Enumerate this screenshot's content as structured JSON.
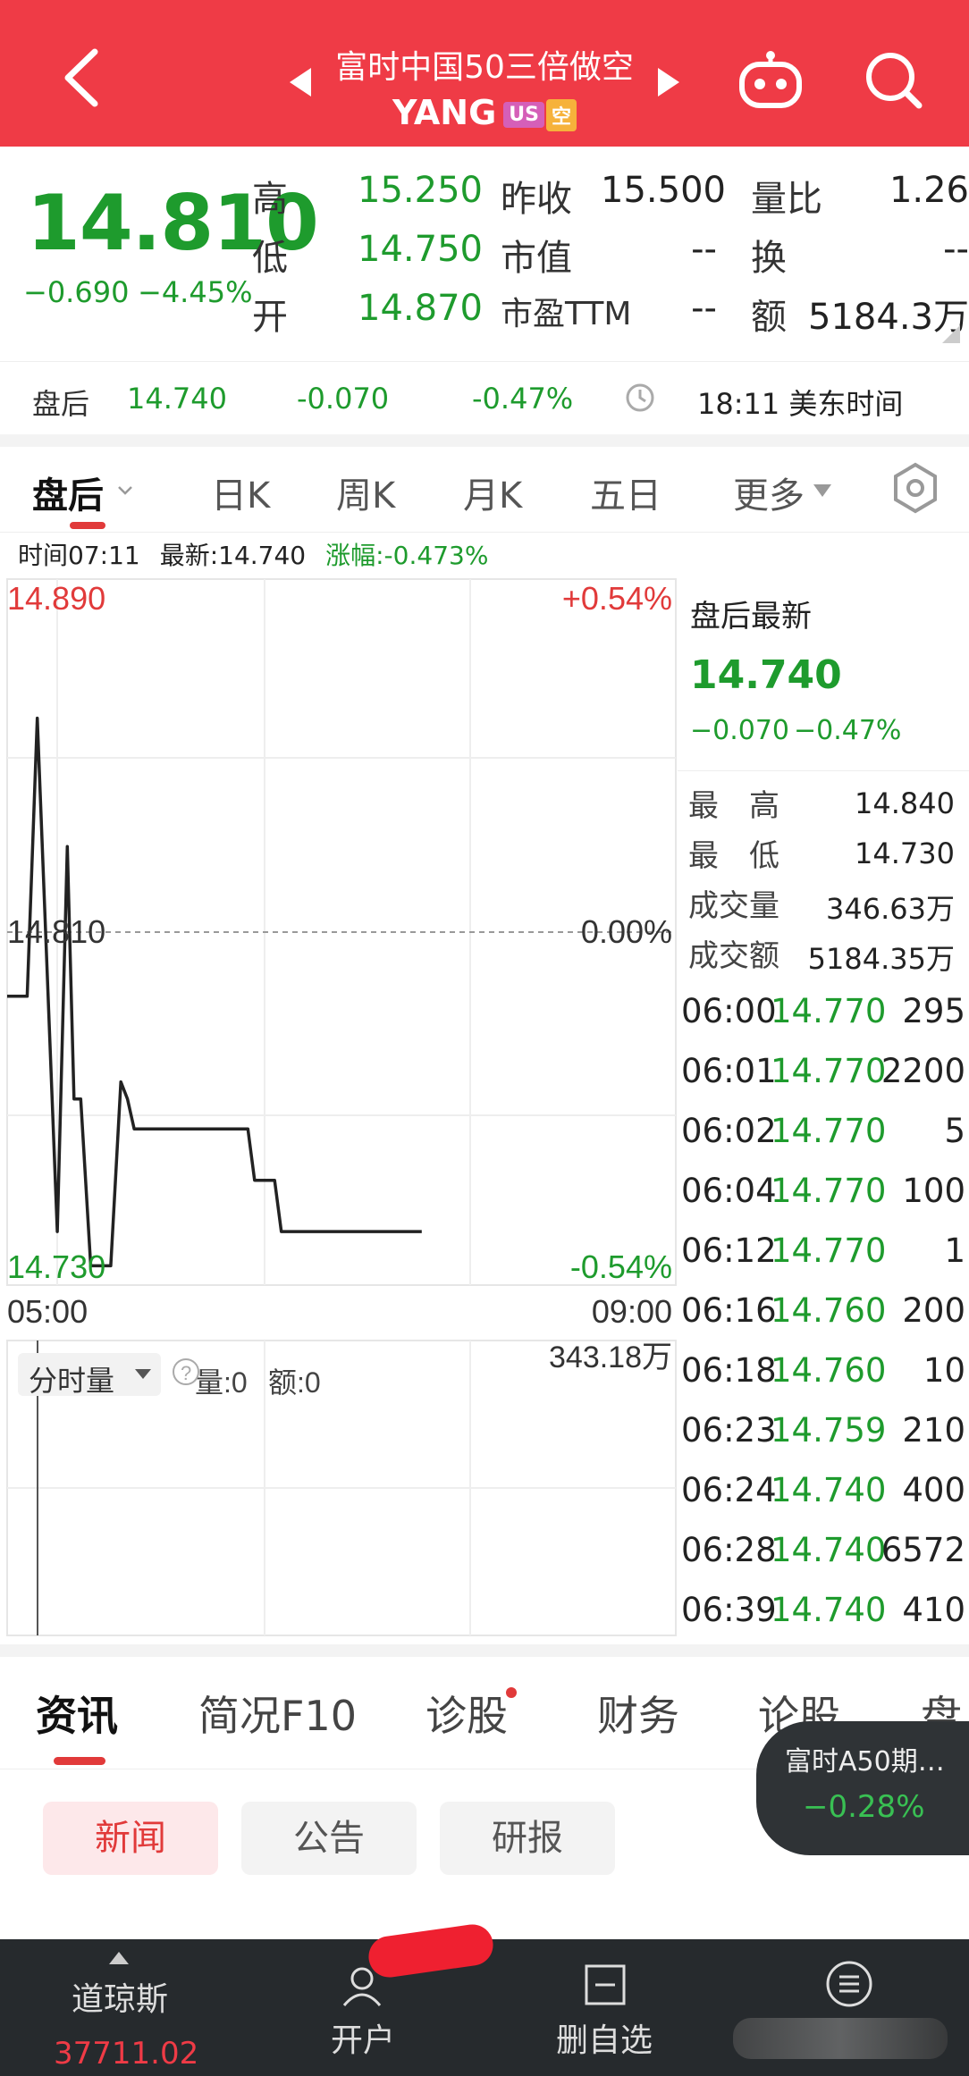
{
  "header": {
    "stock_name": "富时中国50三倍做空",
    "ticker": "YANG",
    "market_badge": "US",
    "short_badge": "空",
    "background_color": "#ef3b46"
  },
  "quote": {
    "price": "14.810",
    "change": "−0.690",
    "change_pct": "−4.45%",
    "high_label": "高",
    "high": "15.250",
    "low_label": "低",
    "low": "14.750",
    "open_label": "开",
    "open": "14.870",
    "prev_close_label": "昨收",
    "prev_close": "15.500",
    "market_cap_label": "市值",
    "market_cap": "--",
    "pe_label": "市盈TTM",
    "pe": "--",
    "vol_ratio_label": "量比",
    "vol_ratio": "1.26",
    "turnover_label": "换",
    "turnover": "--",
    "amount_label": "额",
    "amount": "5184.3万"
  },
  "after_hours": {
    "label": "盘后",
    "price": "14.740",
    "change": "-0.070",
    "change_pct": "-0.47%",
    "time": "18:11 美东时间"
  },
  "chart_tabs": [
    "盘后",
    "日K",
    "周K",
    "月K",
    "五日",
    "更多"
  ],
  "info_row": {
    "time": "时间07:11",
    "latest": "最新:14.740",
    "change": "涨幅:-0.473%"
  },
  "chart_data": {
    "type": "line",
    "y_top": "14.890",
    "y_mid": "14.810",
    "y_bottom": "14.730",
    "pct_top": "+0.54%",
    "pct_mid": "0.00%",
    "pct_bottom": "-0.54%",
    "x_start": "05:00",
    "x_end": "09:00",
    "ylim": [
      14.73,
      14.89
    ],
    "baseline": 14.81,
    "points": [
      [
        0.0,
        14.795
      ],
      [
        0.03,
        14.795
      ],
      [
        0.045,
        14.86
      ],
      [
        0.06,
        14.8
      ],
      [
        0.075,
        14.74
      ],
      [
        0.09,
        14.83
      ],
      [
        0.1,
        14.771
      ],
      [
        0.11,
        14.771
      ],
      [
        0.125,
        14.732
      ],
      [
        0.155,
        14.732
      ],
      [
        0.17,
        14.775
      ],
      [
        0.18,
        14.771
      ],
      [
        0.19,
        14.764
      ],
      [
        0.36,
        14.764
      ],
      [
        0.37,
        14.752
      ],
      [
        0.4,
        14.752
      ],
      [
        0.41,
        14.74
      ],
      [
        0.62,
        14.74
      ]
    ]
  },
  "right_panel": {
    "title": "盘后最新",
    "price": "14.740",
    "change": "−0.070",
    "change_pct": "−0.47%",
    "high_label": "最　高",
    "high": "14.840",
    "low_label": "最　低",
    "low": "14.730",
    "volume_label": "成交量",
    "volume": "346.63万",
    "amount_label": "成交额",
    "amount": "5184.35万",
    "trades": [
      {
        "time": "06:00",
        "price": "14.770",
        "vol": "295"
      },
      {
        "time": "06:01",
        "price": "14.770",
        "vol": "2200"
      },
      {
        "time": "06:02",
        "price": "14.770",
        "vol": "5"
      },
      {
        "time": "06:04",
        "price": "14.770",
        "vol": "100"
      },
      {
        "time": "06:12",
        "price": "14.770",
        "vol": "1"
      },
      {
        "time": "06:16",
        "price": "14.760",
        "vol": "200"
      },
      {
        "time": "06:18",
        "price": "14.760",
        "vol": "10"
      },
      {
        "time": "06:23",
        "price": "14.759",
        "vol": "210"
      },
      {
        "time": "06:24",
        "price": "14.740",
        "vol": "400"
      },
      {
        "time": "06:28",
        "price": "14.740",
        "vol": "6572"
      },
      {
        "time": "06:39",
        "price": "14.740",
        "vol": "410"
      }
    ]
  },
  "volume_section": {
    "selector": "分时量",
    "vol_label": "量:0",
    "amount_label": "额:0",
    "max_label": "343.18万"
  },
  "bottom_tabs": [
    "资讯",
    "简况F10",
    "诊股",
    "财务",
    "论股",
    "盘"
  ],
  "a50_widget": {
    "name": "富时A50期…",
    "pct": "−0.28%"
  },
  "news_chips": [
    "新闻",
    "公告",
    "研报"
  ],
  "footer": {
    "dow_label": "道琼斯",
    "dow_value": "37711.02",
    "open_account": "开户",
    "delete_watch": "删自选"
  }
}
